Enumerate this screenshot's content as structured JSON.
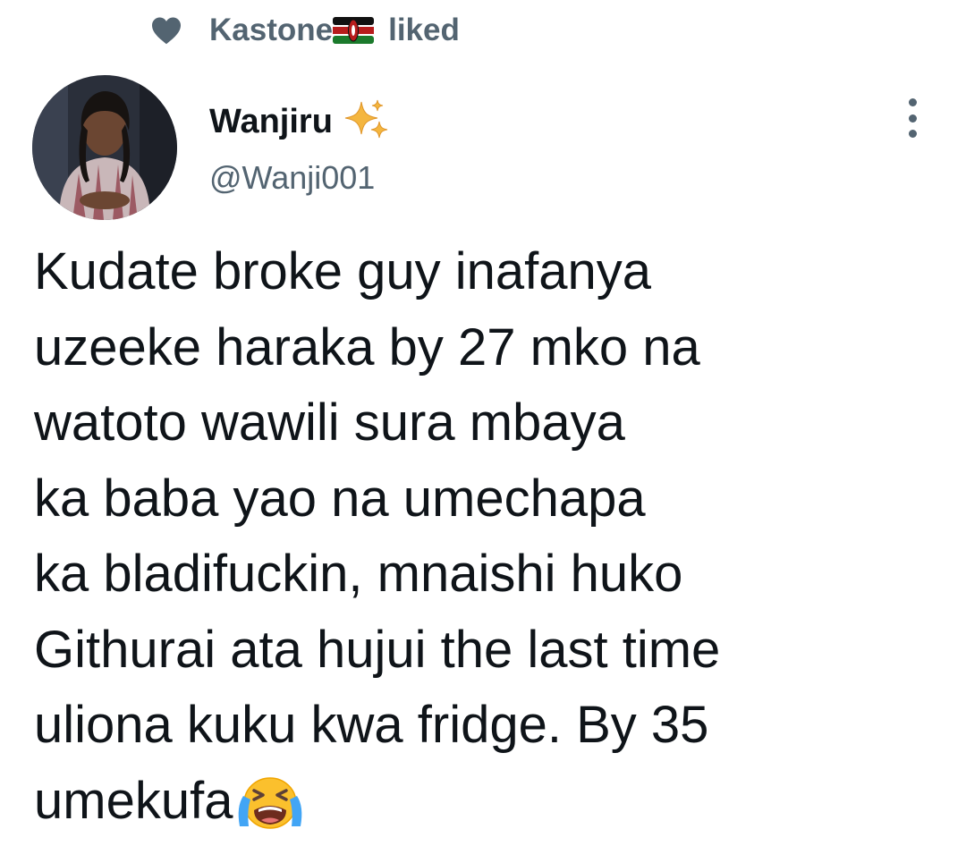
{
  "liked_by": {
    "user": "Kastone",
    "flag_icon": "kenya-flag-icon",
    "action": "liked"
  },
  "author": {
    "display_name": "Wanjiru",
    "badge_icon": "sparkles-icon",
    "handle": "@Wanji001"
  },
  "tweet": {
    "lines": [
      "Kudate broke guy inafanya",
      "uzeeke haraka by 27 mko na",
      "watoto wawili sura mbaya",
      "ka baba yao na umechapa",
      "ka bladifuckin, mnaishi huko",
      "Githurai ata hujui the last time",
      "uliona kuku kwa fridge. By 35",
      "umekufa"
    ],
    "trailing_emoji": "loudly-crying-face-emoji"
  },
  "colors": {
    "text": "#0f1419",
    "secondary": "#536471",
    "heart": "#536471"
  }
}
